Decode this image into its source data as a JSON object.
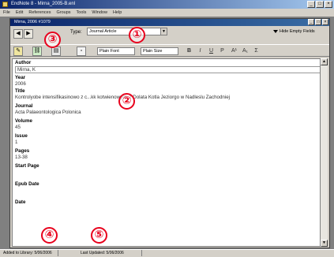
{
  "app": {
    "title": "EndNote 8 - Mirna_2005-B.enl",
    "menu": [
      "File",
      "Edit",
      "References",
      "Groups",
      "Tools",
      "Window",
      "Help"
    ]
  },
  "doc_window": {
    "title": "Mirna, 2006 #1079"
  },
  "toolbar": {
    "ref_type_label": "Type:",
    "ref_type_value": "Journal Article",
    "hide_empty": "Hide Empty Fields",
    "font_value": "Plain Font",
    "size_value": "Plain Size",
    "format_buttons": [
      "B",
      "I",
      "U",
      "P",
      "A¹",
      "A₁",
      "Σ"
    ]
  },
  "fields": [
    {
      "label": "Author",
      "value": "Mirna, K"
    },
    {
      "label": "Year",
      "value": "2006"
    },
    {
      "label": "Title",
      "value": "Kontrolyobe intensifikasinowo z c...kk kotwienowych z Dolata Kotla Jeziorgo w Nadleslu Zachodniej"
    },
    {
      "label": "Journal",
      "value": "Acta Palaeontologica Polonica"
    },
    {
      "label": "Volume",
      "value": "45"
    },
    {
      "label": "Issue",
      "value": "1"
    },
    {
      "label": "Pages",
      "value": "13-38"
    },
    {
      "label": "Start Page",
      "value": ""
    },
    {
      "label": "Epub Date",
      "value": ""
    },
    {
      "label": "Date",
      "value": ""
    }
  ],
  "status": {
    "left": "Added to Library: 5/06/2006",
    "right": "Last Updated: 5/06/2006"
  },
  "markers": [
    "①",
    "②",
    "③",
    "④",
    "⑤"
  ]
}
